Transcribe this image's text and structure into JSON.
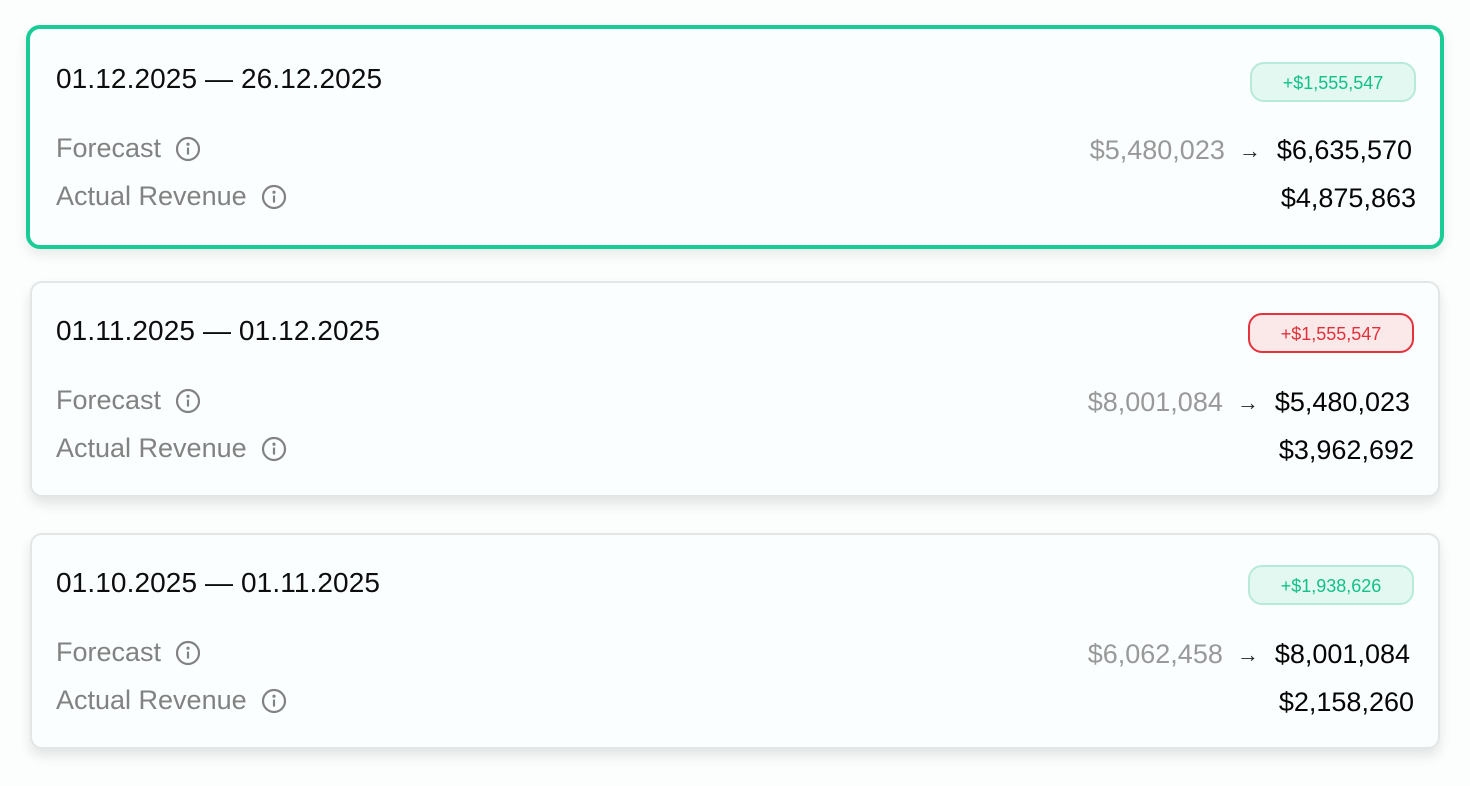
{
  "periods": [
    {
      "date_range": "01.12.2025 — 26.12.2025",
      "delta": "+$1,555,547",
      "delta_status": "positive",
      "selected": true,
      "forecast_label": "Forecast",
      "forecast_from": "$5,480,023",
      "forecast_arrow": "→",
      "forecast_to": "$6,635,570",
      "actual_label": "Actual Revenue",
      "actual_value": "$4,875,863"
    },
    {
      "date_range": "01.11.2025 — 01.12.2025",
      "delta": "+$1,555,547",
      "delta_status": "negative",
      "selected": false,
      "forecast_label": "Forecast",
      "forecast_from": "$8,001,084",
      "forecast_arrow": "→",
      "forecast_to": "$5,480,023",
      "actual_label": "Actual Revenue",
      "actual_value": "$3,962,692"
    },
    {
      "date_range": "01.10.2025 — 01.11.2025",
      "delta": "+$1,938,626",
      "delta_status": "positive",
      "selected": false,
      "forecast_label": "Forecast",
      "forecast_from": "$6,062,458",
      "forecast_arrow": "→",
      "forecast_to": "$8,001,084",
      "actual_label": "Actual Revenue",
      "actual_value": "$2,158,260"
    }
  ],
  "icons": {
    "info": "info-circle-icon"
  },
  "colors": {
    "selected_border": "#19cc95",
    "positive_text": "#12c08a",
    "positive_bg": "#e3f8f0",
    "negative_text": "#e0323c",
    "negative_border": "#e5323d",
    "negative_bg": "#fbe8e8",
    "muted_text": "#828282"
  }
}
